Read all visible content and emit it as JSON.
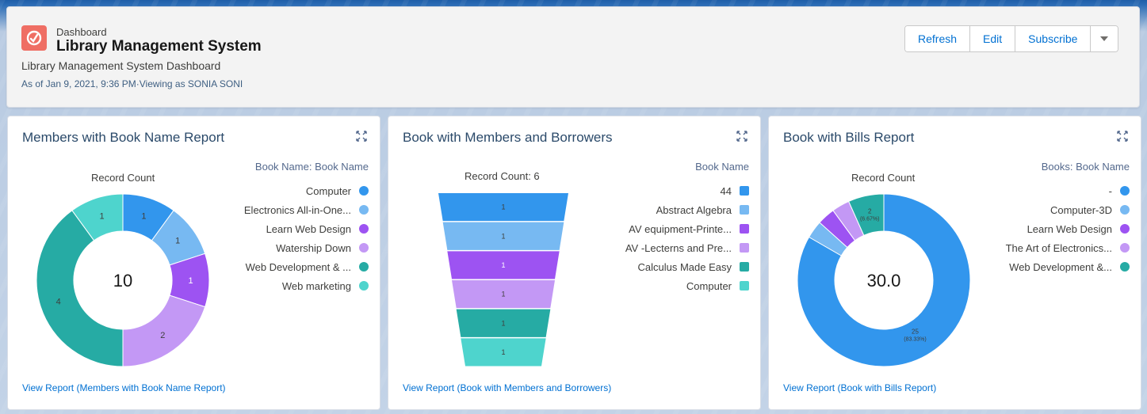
{
  "header": {
    "eyebrow": "Dashboard",
    "title": "Library Management System",
    "subtitle": "Library Management System Dashboard",
    "as_of": "As of Jan 9, 2021, 9:36 PM·Viewing as SONIA SONI",
    "buttons": {
      "refresh": "Refresh",
      "edit": "Edit",
      "subscribe": "Subscribe"
    },
    "icon": "dashboard-gauge-icon",
    "icon_color": "#ef6e64"
  },
  "cards": [
    {
      "title": "Members with Book Name Report",
      "record_label": "Record Count",
      "legend_title": "Book Name: Book Name",
      "center": "10",
      "view_link": "View Report (Members with Book Name Report)",
      "legend": [
        {
          "label": "Computer",
          "color": "#3296ed"
        },
        {
          "label": "Electronics All-in-One...",
          "color": "#77b9f2"
        },
        {
          "label": "Learn Web Design",
          "color": "#9d53f2"
        },
        {
          "label": "Watership Down",
          "color": "#c398f5"
        },
        {
          "label": "Web Development & ...",
          "color": "#26aba4"
        },
        {
          "label": "Web marketing",
          "color": "#4ed4cd"
        }
      ]
    },
    {
      "title": "Book with Members and Borrowers",
      "record_label": "Record Count: 6",
      "legend_title": "Book Name",
      "view_link": "View Report (Book with Members and Borrowers)",
      "legend": [
        {
          "label": "44",
          "color": "#3296ed"
        },
        {
          "label": "Abstract Algebra",
          "color": "#77b9f2"
        },
        {
          "label": "AV equipment-Printe...",
          "color": "#9d53f2"
        },
        {
          "label": "AV -Lecterns and Pre...",
          "color": "#c398f5"
        },
        {
          "label": "Calculus Made Easy",
          "color": "#26aba4"
        },
        {
          "label": "Computer",
          "color": "#4ed4cd"
        }
      ]
    },
    {
      "title": "Book with Bills Report",
      "record_label": "Record Count",
      "legend_title": "Books: Book Name",
      "center": "30.0",
      "view_link": "View Report (Book with Bills Report)",
      "legend": [
        {
          "label": "-",
          "color": "#3296ed"
        },
        {
          "label": "Computer-3D",
          "color": "#77b9f2"
        },
        {
          "label": "Learn Web Design",
          "color": "#9d53f2"
        },
        {
          "label": "The Art of Electronics...",
          "color": "#c398f5"
        },
        {
          "label": "Web Development &...",
          "color": "#26aba4"
        }
      ]
    }
  ],
  "chart_data": [
    {
      "type": "donut",
      "title": "Members with Book Name Report",
      "categories": [
        "Computer",
        "Electronics All-in-One...",
        "Learn Web Design",
        "Watership Down",
        "Web Development & ...",
        "Web marketing"
      ],
      "values": [
        1,
        1,
        1,
        2,
        4,
        1
      ],
      "colors": [
        "#3296ed",
        "#77b9f2",
        "#9d53f2",
        "#c398f5",
        "#26aba4",
        "#4ed4cd"
      ],
      "total": 10
    },
    {
      "type": "funnel",
      "title": "Book with Members and Borrowers",
      "categories": [
        "44",
        "Abstract Algebra",
        "AV equipment-Printe...",
        "AV -Lecterns and Pre...",
        "Calculus Made Easy",
        "Computer"
      ],
      "values": [
        1,
        1,
        1,
        1,
        1,
        1
      ],
      "colors": [
        "#3296ed",
        "#77b9f2",
        "#9d53f2",
        "#c398f5",
        "#26aba4",
        "#4ed4cd"
      ],
      "total": 6
    },
    {
      "type": "donut",
      "title": "Book with Bills Report",
      "categories": [
        "-",
        "Computer-3D",
        "Learn Web Design",
        "The Art of Electronics...",
        "Web Development &..."
      ],
      "values": [
        25,
        1,
        1,
        1,
        2
      ],
      "colors": [
        "#3296ed",
        "#77b9f2",
        "#9d53f2",
        "#c398f5",
        "#26aba4"
      ],
      "data_labels": [
        {
          "index": 0,
          "value": "25",
          "pct": "(83.33%)"
        },
        {
          "index": 4,
          "value": "2",
          "pct": "(6.67%)"
        }
      ],
      "total": "30.0"
    }
  ]
}
